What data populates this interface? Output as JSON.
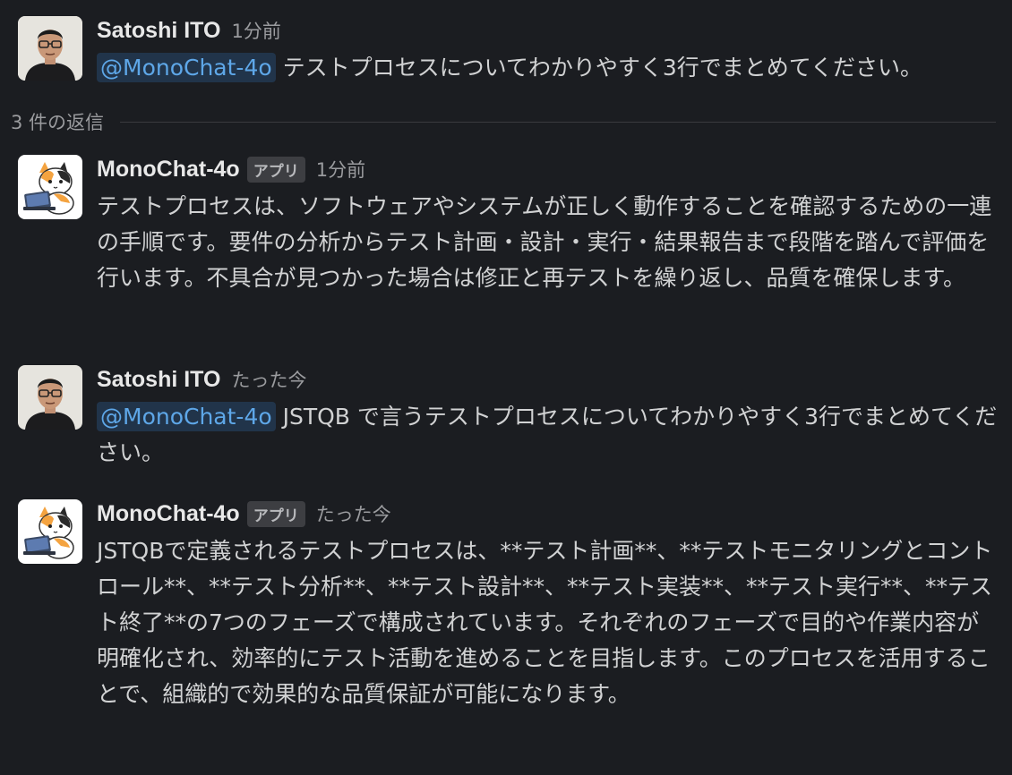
{
  "messages": [
    {
      "author": "Satoshi ITO",
      "time": "1分前",
      "mention": "@MonoChat-4o",
      "text": " テストプロセスについてわかりやすく3行でまとめてください。"
    },
    {
      "author": "MonoChat-4o",
      "badge": "アプリ",
      "time": "1分前",
      "text": "テストプロセスは、ソフトウェアやシステムが正しく動作することを確認するための一連の手順です。要件の分析からテスト計画・設計・実行・結果報告まで段階を踏んで評価を行います。不具合が見つかった場合は修正と再テストを繰り返し、品質を確保します。"
    },
    {
      "author": "Satoshi ITO",
      "time": "たった今",
      "mention": "@MonoChat-4o",
      "text": " JSTQB で言うテストプロセスについてわかりやすく3行でまとめてください。"
    },
    {
      "author": "MonoChat-4o",
      "badge": "アプリ",
      "time": "たった今",
      "text": "JSTQBで定義されるテストプロセスは、**テスト計画**、**テストモニタリングとコントロール**、**テスト分析**、**テスト設計**、**テスト実装**、**テスト実行**、**テスト終了**の7つのフェーズで構成されています。それぞれのフェーズで目的や作業内容が明確化され、効率的にテスト活動を進めることを目指します。このプロセスを活用することで、組織的で効果的な品質保証が可能になります。"
    }
  ],
  "replies_label": "3 件の返信",
  "icons": {
    "user_avatar": "person-avatar-icon",
    "bot_avatar": "cat-with-laptop-avatar-icon"
  }
}
